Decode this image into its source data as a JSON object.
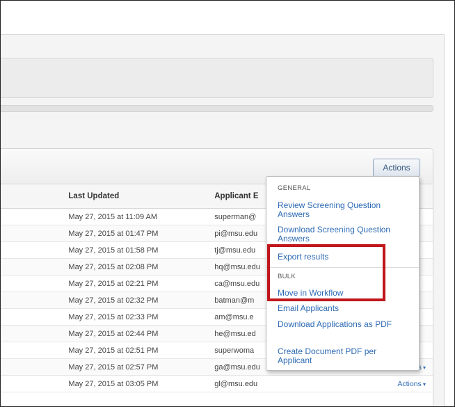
{
  "toolbar": {
    "actions_label": "Actions"
  },
  "table": {
    "headers": [
      "",
      "Last Updated",
      "Applicant E",
      ""
    ],
    "rows": [
      {
        "updated": "May 27, 2015 at 11:09 AM",
        "email": "superman@",
        "actions": ""
      },
      {
        "updated": "May 27, 2015 at 01:47 PM",
        "email": "pi@msu.edu",
        "actions": ""
      },
      {
        "updated": "May 27, 2015 at 01:58 PM",
        "email": "tj@msu.edu",
        "actions": ""
      },
      {
        "updated": "May 27, 2015 at 02:08 PM",
        "email": "hq@msu.edu",
        "actions": ""
      },
      {
        "updated": "May 27, 2015 at 02:21 PM",
        "email": "ca@msu.edu",
        "actions": ""
      },
      {
        "updated": "May 27, 2015 at 02:32 PM",
        "email": "batman@m",
        "actions": ""
      },
      {
        "updated": "May 27, 2015 at 02:33 PM",
        "email": "am@msu.e",
        "actions": ""
      },
      {
        "updated": "May 27, 2015 at 02:44 PM",
        "email": "he@msu.ed",
        "actions": ""
      },
      {
        "updated": "May 27, 2015 at 02:51 PM",
        "email": "superwoma",
        "actions": ""
      },
      {
        "updated": "May 27, 2015 at 02:57 PM",
        "email": "ga@msu.edu",
        "actions": "Actions"
      },
      {
        "updated": "May 27, 2015 at 03:05 PM",
        "email": "gl@msu.edu",
        "actions": "Actions"
      }
    ]
  },
  "dropdown": {
    "general_label": "GENERAL",
    "bulk_label": "BULK",
    "general_items": [
      "Review Screening Question Answers",
      "Download Screening Question Answers",
      "Export results"
    ],
    "bulk_items": [
      "Move in Workflow",
      "Email Applicants",
      "Download Applications as PDF",
      "Create Document PDF per Applicant"
    ]
  },
  "colors": {
    "link": "#2d6ab4",
    "highlight": "#c0161c"
  }
}
